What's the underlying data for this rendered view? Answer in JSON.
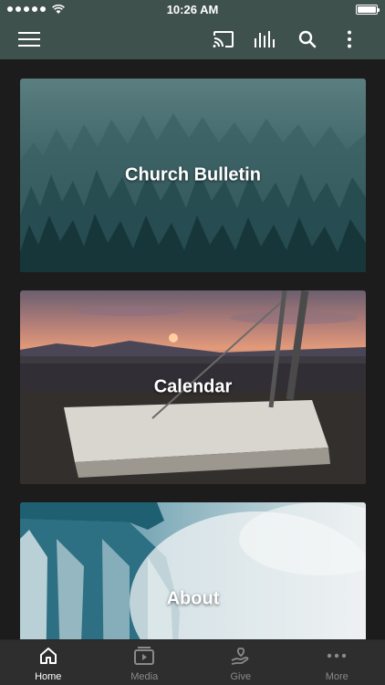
{
  "status_bar": {
    "time": "10:26 AM",
    "signal_bars": 5,
    "battery_level": 1.0
  },
  "app_bar": {
    "icons": [
      "menu-icon",
      "cast-icon",
      "audio-levels-icon",
      "search-icon",
      "more-vertical-icon"
    ]
  },
  "cards": [
    {
      "title": "Church Bulletin",
      "image": "misty-forest"
    },
    {
      "title": "Calendar",
      "image": "sunset-sundial"
    },
    {
      "title": "About",
      "image": "waterfall"
    }
  ],
  "tabs": [
    {
      "label": "Home",
      "icon": "home-icon",
      "active": true
    },
    {
      "label": "Media",
      "icon": "media-play-icon",
      "active": false
    },
    {
      "label": "Give",
      "icon": "give-hand-heart-icon",
      "active": false
    },
    {
      "label": "More",
      "icon": "more-horizontal-icon",
      "active": false
    }
  ],
  "colors": {
    "header": "#3f514d",
    "tab_bar": "#2e2e2e",
    "tab_inactive": "#8a8a8a",
    "tab_active": "#ffffff"
  }
}
